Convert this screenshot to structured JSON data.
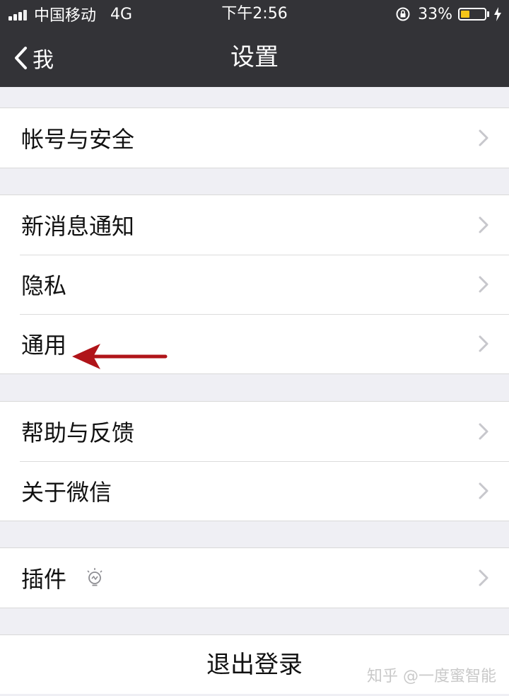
{
  "status_bar": {
    "carrier": "中国移动",
    "network": "4G",
    "time": "下午2:56",
    "battery": "33%",
    "battery_color": "#f5c518"
  },
  "nav": {
    "back_label": "我",
    "title": "设置"
  },
  "groups": [
    {
      "items": [
        {
          "label": "帐号与安全"
        }
      ]
    },
    {
      "items": [
        {
          "label": "新消息通知"
        },
        {
          "label": "隐私"
        },
        {
          "label": "通用"
        }
      ]
    },
    {
      "items": [
        {
          "label": "帮助与反馈"
        },
        {
          "label": "关于微信"
        }
      ]
    },
    {
      "items": [
        {
          "label": "插件",
          "icon": "lightbulb-icon"
        }
      ]
    }
  ],
  "logout_label": "退出登录",
  "annotation": {
    "arrow_color": "#b01419",
    "arrow_target": "通用"
  },
  "watermark": "知乎 @一度蜜智能",
  "colors": {
    "nav_bg": "#333337",
    "page_bg": "#efeff4"
  }
}
